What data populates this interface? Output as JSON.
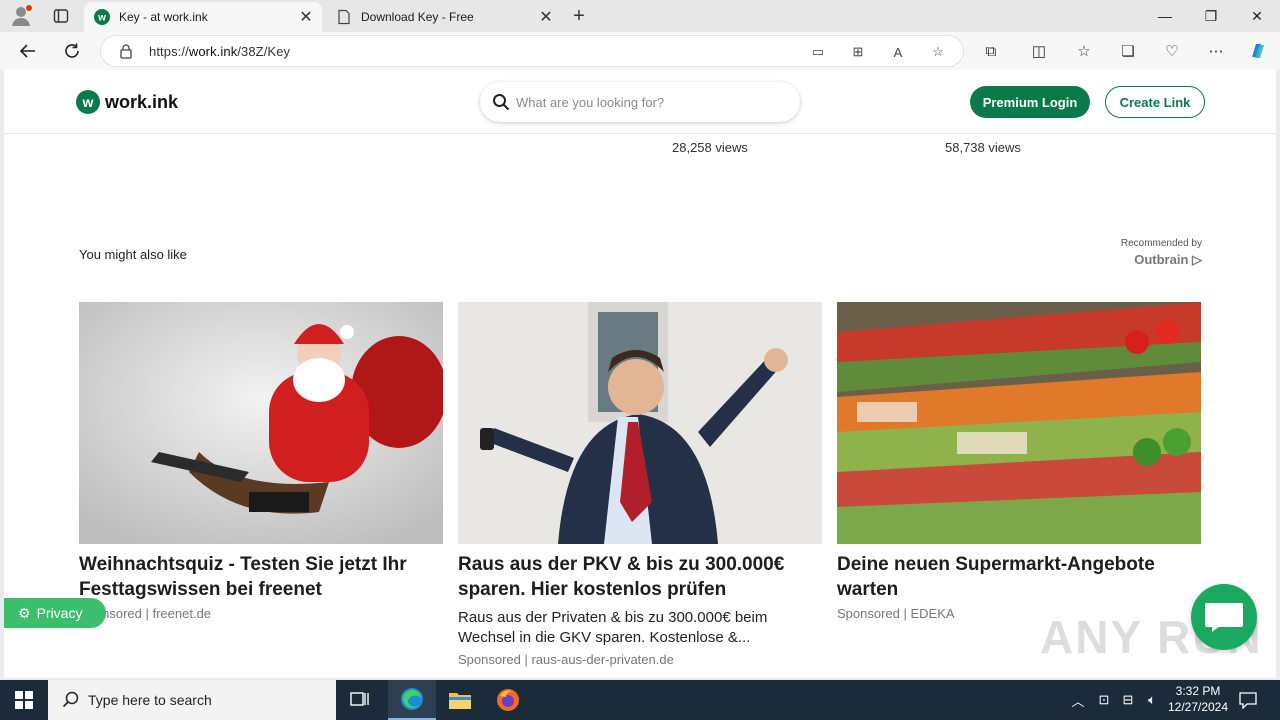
{
  "browser": {
    "tabs": [
      {
        "title": "Key - at work.ink",
        "active": true
      },
      {
        "title": "Download Key - Free",
        "active": false
      }
    ],
    "url_prefix": "https://",
    "url_host": "work.ink",
    "url_path": "/38Z/Key"
  },
  "site": {
    "logo_mark": "w",
    "logo_text": "work.ink",
    "search_placeholder": "What are you looking for?",
    "premium_login": "Premium Login",
    "create_link": "Create Link",
    "colors": {
      "brand": "#0b7a4b",
      "privacy": "#3cbf6c",
      "chat": "#1aa960"
    }
  },
  "views": [
    "28,258 views",
    "58,738 views"
  ],
  "recommendations": {
    "heading": "You might also like",
    "recommended_by": "Recommended by",
    "provider": "Outbrain",
    "cards": [
      {
        "headline": "Weihnachtsquiz - Testen Sie jetzt Ihr Festtagswissen bei freenet",
        "description": "",
        "source": "Sponsored | freenet.de"
      },
      {
        "headline": "Raus aus der PKV & bis zu 300.000€ sparen. Hier kostenlos prüfen",
        "description": "Raus aus der Privaten & bis zu 300.000€ beim Wechsel in die GKV sparen. Kostenlose &...",
        "source": "Sponsored | raus-aus-der-privaten.de"
      },
      {
        "headline": "Deine neuen Supermarkt-Angebote warten",
        "description": "",
        "source": "Sponsored | EDEKA"
      }
    ]
  },
  "privacy_label": "Privacy",
  "watermark": "ANY RUN",
  "taskbar": {
    "search_label": "Type here to search",
    "time": "3:32 PM",
    "date": "12/27/2024"
  }
}
